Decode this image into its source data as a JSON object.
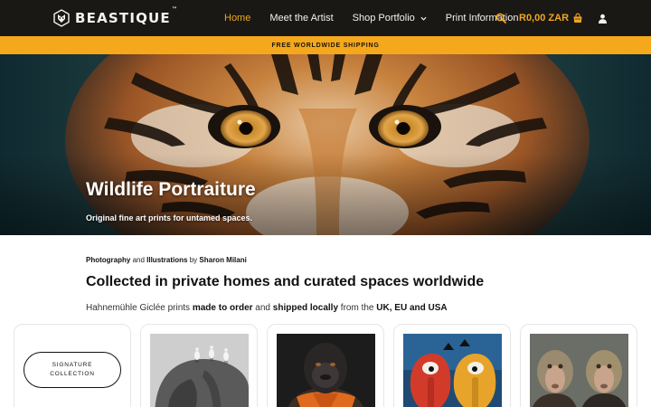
{
  "header": {
    "logo_text": "BEASTIQUE",
    "logo_tm": "™",
    "nav": [
      {
        "label": "Home",
        "active": true
      },
      {
        "label": "Meet the Artist"
      },
      {
        "label": "Shop Portfolio",
        "has_dropdown": true
      },
      {
        "label": "Print Information"
      }
    ],
    "cart_total": "R0,00 ZAR",
    "icons": [
      "search-icon",
      "shopping-bag-icon",
      "user-icon"
    ],
    "accent_color": "#f0a623"
  },
  "shipping_bar": {
    "text": "FREE WORLDWIDE SHIPPING",
    "color": "#f5a81c"
  },
  "hero": {
    "title": "Wildlife Portraiture",
    "subtitle": "Original fine art prints for untamed spaces."
  },
  "intro": {
    "byline": {
      "part1": "Photography",
      "and": " and ",
      "part2": "Illustrations",
      "by": " by ",
      "artist": "Sharon Milani"
    },
    "headline": "Collected in private homes and curated spaces worldwide",
    "sub": {
      "t1": "Hahnemühle Giclée prints ",
      "b1": "made to order",
      "t2": " and ",
      "b2": "shipped locally",
      "t3": " from the ",
      "b3": "UK, EU and USA"
    }
  },
  "collections": {
    "signature_line1": "SIGNATURE",
    "signature_line2": "COLLECTION",
    "thumbnails": [
      "elephant-with-egrets",
      "gorilla-in-orange-scarf",
      "painted-elephants",
      "baboons-in-jackets"
    ]
  }
}
